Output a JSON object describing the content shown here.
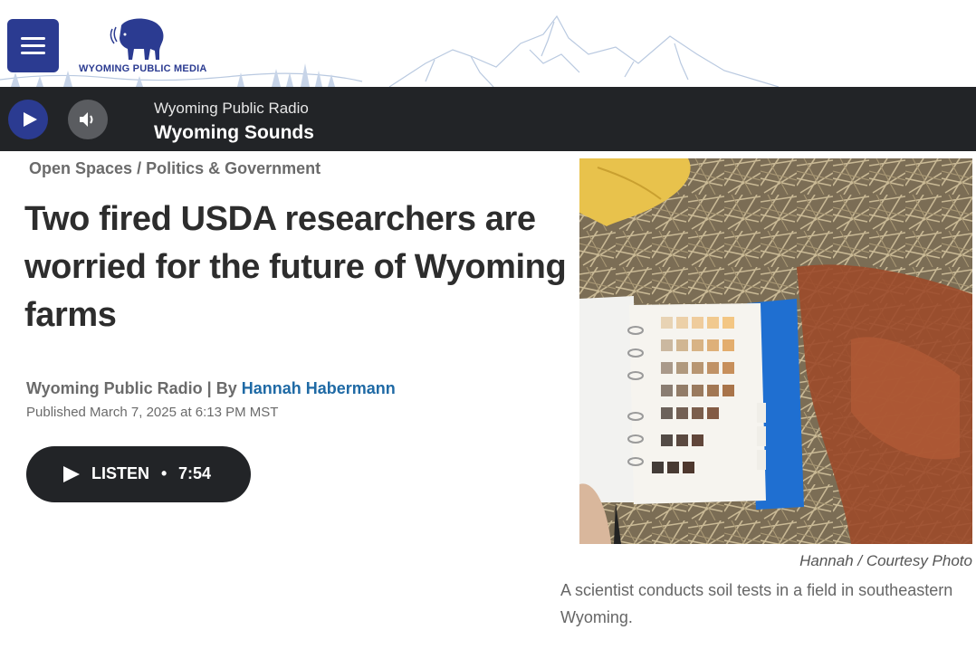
{
  "header": {
    "logo_text": "WYOMING PUBLIC MEDIA",
    "brand_color": "#2b3b91"
  },
  "player": {
    "station": "Wyoming Public Radio",
    "program": "Wyoming Sounds"
  },
  "article": {
    "breadcrumb": [
      "Open Spaces",
      "Politics & Government"
    ],
    "breadcrumb_separator": "/",
    "headline": "Two fired USDA researchers are worried for the future of Wyoming farms",
    "byline_source": "Wyoming Public Radio | By",
    "byline_author": "Hannah Habermann",
    "published": "Published March 7, 2025 at 6:13 PM MST",
    "listen_label": "LISTEN",
    "listen_separator": "•",
    "listen_duration": "7:54"
  },
  "photo": {
    "credit": "Hannah  /  Courtesy Photo",
    "caption": "A scientist conducts soil tests in a field in southeastern Wyoming.",
    "icons": [
      "menu-icon",
      "play-icon",
      "volume-icon",
      "bison-logo"
    ]
  },
  "colors": {
    "player_bg": "#222427",
    "author_link": "#1f6aa5",
    "heading": "#2d2d2d"
  }
}
